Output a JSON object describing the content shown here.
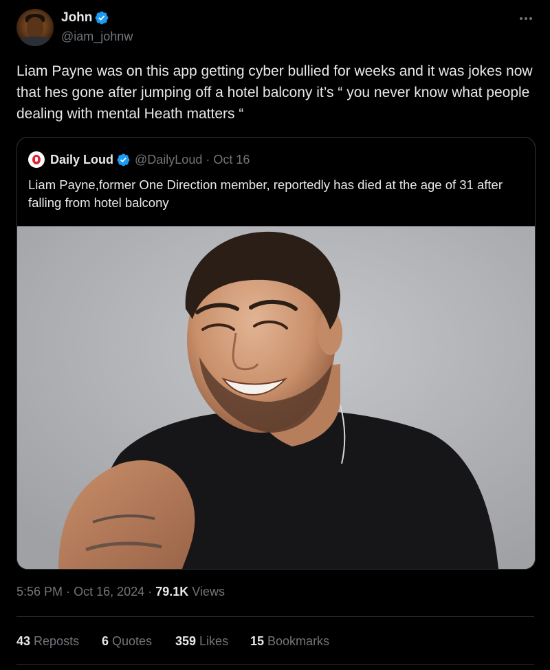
{
  "author": {
    "display_name": "John",
    "handle": "@iam_johnw",
    "verified": true,
    "avatar_icon": "user-avatar"
  },
  "tweet": {
    "text": "Liam Payne was on this app getting cyber bullied for weeks and it was jokes now that hes gone after jumping off a hotel balcony it’s “ you never know what people dealing with mental Heath matters “"
  },
  "quote": {
    "display_name": "Daily Loud",
    "handle": "@DailyLoud",
    "separator": "·",
    "date": "Oct 16",
    "verified": true,
    "text": "Liam Payne,former One Direction member, reportedly has died at the age of 31 after falling from hotel balcony",
    "image_icon": "photo-portrait"
  },
  "meta": {
    "time": "5:56 PM",
    "sep1": "·",
    "date": "Oct 16, 2024",
    "sep2": "·",
    "views_count": "79.1K",
    "views_label": "Views"
  },
  "stats": {
    "reposts_count": "43",
    "reposts_label": "Reposts",
    "quotes_count": "6",
    "quotes_label": "Quotes",
    "likes_count": "359",
    "likes_label": "Likes",
    "bookmarks_count": "15",
    "bookmarks_label": "Bookmarks"
  },
  "colors": {
    "background": "#000000",
    "text_primary": "#e7e9ea",
    "text_secondary": "#71767b",
    "border": "#2f3336",
    "verified_blue": "#1d9bf0"
  }
}
